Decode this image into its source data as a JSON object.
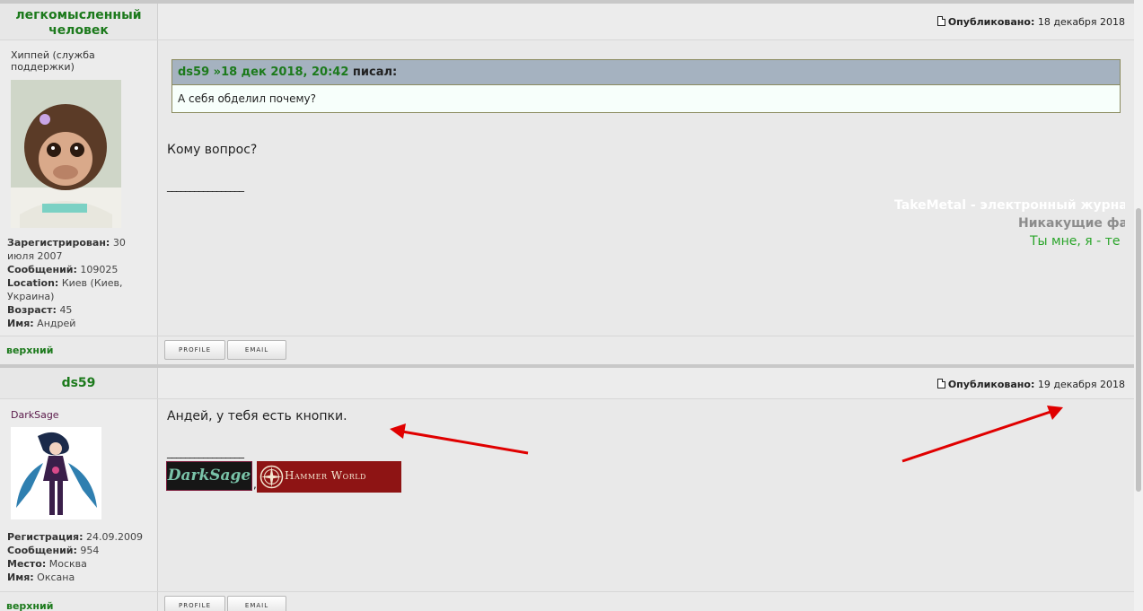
{
  "post1": {
    "author": "легкомысленный человек",
    "published_label": "Опубликовано:",
    "date": "18 декабря 2018",
    "rank": "Хиппей (служба поддержки)",
    "avatar": "monkey-avatar",
    "profile": [
      {
        "label": "Зарегистрирован:",
        "value": "30 июля 2007"
      },
      {
        "label": "Сообщений:",
        "value": "109025"
      },
      {
        "label": "Location:",
        "value": "Киев (Киев, Украина)"
      },
      {
        "label": "Возраст:",
        "value": "45"
      },
      {
        "label": "Имя:",
        "value": "Андрей"
      }
    ],
    "quote": {
      "author": "ds59",
      "link": "»18 дек 2018, 20:42",
      "wrote": "писал:",
      "text": "А себя обделил почему?"
    },
    "message": "Кому вопрос?",
    "sig_line": "_________________",
    "signature": {
      "line1": "TakeMetal - электронный журнал, ",
      "line2": "Никакущие фак",
      "line3": "Ты мне, я - те",
      "color1": "#ffffff",
      "color2": "#8c8c8c",
      "color3": "#2aa52a"
    },
    "top_link": "верхний",
    "buttons": {
      "profile": "PROFILE",
      "email": "EMAIL"
    }
  },
  "post2": {
    "author": "ds59",
    "published_label": "Опубликовано:",
    "date": "19 декабря 2018",
    "rank": "DarkSage",
    "avatar": "fantasy-figure-avatar",
    "profile": [
      {
        "label": "Регистрация:",
        "value": "24.09.2009"
      },
      {
        "label": "Сообщений:",
        "value": "954"
      },
      {
        "label": "Место:",
        "value": "Москва"
      },
      {
        "label": "Имя:",
        "value": "Оксана"
      }
    ],
    "message": "Андей, у тебя есть кнопки.",
    "sig_line": "_________________",
    "banners": {
      "darksage": "DarkSage",
      "separator": ",",
      "hammer": "Hammer World"
    },
    "top_link": "верхний",
    "buttons": {
      "profile": "PROFILE",
      "email": "EMAIL"
    }
  },
  "colors": {
    "author_green": "#1c7a1c",
    "background": "#e9e9e9",
    "quote_header": "#a5b2c0",
    "arrow_red": "#e00000"
  }
}
